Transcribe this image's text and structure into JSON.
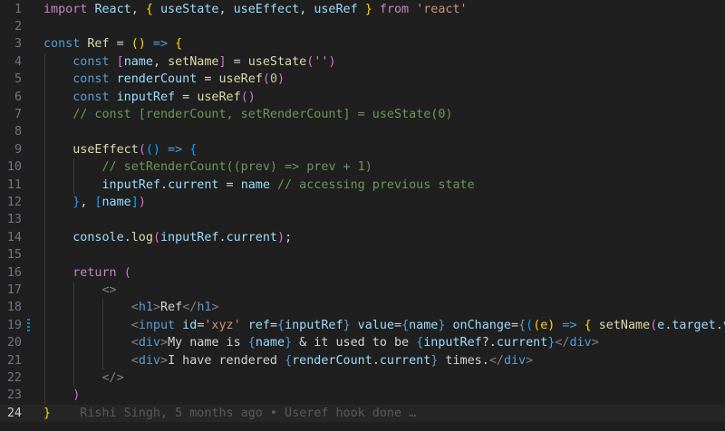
{
  "editor": {
    "current_line": 24,
    "modified_line": 19,
    "lines": [
      {
        "n": "1",
        "tokens": [
          [
            "import ",
            "kc"
          ],
          [
            "React",
            "v"
          ],
          [
            ", ",
            "plain"
          ],
          [
            "{ ",
            "b1"
          ],
          [
            "useState",
            "v"
          ],
          [
            ", ",
            "plain"
          ],
          [
            "useEffect",
            "v"
          ],
          [
            ", ",
            "plain"
          ],
          [
            "useRef",
            "v"
          ],
          [
            " }",
            "b1"
          ],
          [
            " from ",
            "kc"
          ],
          [
            "'react'",
            "s"
          ]
        ]
      },
      {
        "n": "2",
        "tokens": []
      },
      {
        "n": "3",
        "tokens": [
          [
            "const ",
            "k"
          ],
          [
            "Ref",
            "f"
          ],
          [
            " = ",
            "plain"
          ],
          [
            "()",
            "b1"
          ],
          [
            " => ",
            "k"
          ],
          [
            "{",
            "b1"
          ]
        ]
      },
      {
        "n": "4",
        "tokens": [
          [
            "    ",
            "plain"
          ],
          [
            "const ",
            "k"
          ],
          [
            "[",
            "b2"
          ],
          [
            "name",
            "v"
          ],
          [
            ", ",
            "plain"
          ],
          [
            "setName",
            "f"
          ],
          [
            "]",
            "b2"
          ],
          [
            " = ",
            "plain"
          ],
          [
            "useState",
            "f"
          ],
          [
            "(",
            "b2"
          ],
          [
            "''",
            "s"
          ],
          [
            ")",
            "b2"
          ]
        ]
      },
      {
        "n": "5",
        "tokens": [
          [
            "    ",
            "plain"
          ],
          [
            "const ",
            "k"
          ],
          [
            "renderCount",
            "v"
          ],
          [
            " = ",
            "plain"
          ],
          [
            "useRef",
            "f"
          ],
          [
            "(",
            "b2"
          ],
          [
            "0",
            "n"
          ],
          [
            ")",
            "b2"
          ]
        ]
      },
      {
        "n": "6",
        "tokens": [
          [
            "    ",
            "plain"
          ],
          [
            "const ",
            "k"
          ],
          [
            "inputRef",
            "v"
          ],
          [
            " = ",
            "plain"
          ],
          [
            "useRef",
            "f"
          ],
          [
            "()",
            "b2"
          ]
        ]
      },
      {
        "n": "7",
        "tokens": [
          [
            "    ",
            "plain"
          ],
          [
            "// const [renderCount, setRenderCount] = useState(0)",
            "c"
          ]
        ]
      },
      {
        "n": "8",
        "tokens": []
      },
      {
        "n": "9",
        "tokens": [
          [
            "    ",
            "plain"
          ],
          [
            "useEffect",
            "f"
          ],
          [
            "(",
            "b2"
          ],
          [
            "()",
            "b3"
          ],
          [
            " => ",
            "k"
          ],
          [
            "{",
            "b3"
          ]
        ]
      },
      {
        "n": "10",
        "tokens": [
          [
            "        ",
            "plain"
          ],
          [
            "// setRenderCount((prev) => prev + 1)",
            "c"
          ]
        ]
      },
      {
        "n": "11",
        "tokens": [
          [
            "        ",
            "plain"
          ],
          [
            "inputRef",
            "v"
          ],
          [
            ".",
            "plain"
          ],
          [
            "current",
            "v"
          ],
          [
            " = ",
            "plain"
          ],
          [
            "name",
            "v"
          ],
          [
            " // accessing previous state",
            "c"
          ]
        ]
      },
      {
        "n": "12",
        "tokens": [
          [
            "    ",
            "plain"
          ],
          [
            "}",
            "b3"
          ],
          [
            ", ",
            "plain"
          ],
          [
            "[",
            "b3"
          ],
          [
            "name",
            "v"
          ],
          [
            "]",
            "b3"
          ],
          [
            ")",
            "b2"
          ]
        ]
      },
      {
        "n": "13",
        "tokens": []
      },
      {
        "n": "14",
        "tokens": [
          [
            "    ",
            "plain"
          ],
          [
            "console",
            "v"
          ],
          [
            ".",
            "plain"
          ],
          [
            "log",
            "f"
          ],
          [
            "(",
            "b2"
          ],
          [
            "inputRef",
            "v"
          ],
          [
            ".",
            "plain"
          ],
          [
            "current",
            "v"
          ],
          [
            ")",
            "b2"
          ],
          [
            ";",
            "plain"
          ]
        ]
      },
      {
        "n": "15",
        "tokens": []
      },
      {
        "n": "16",
        "tokens": [
          [
            "    ",
            "plain"
          ],
          [
            "return ",
            "kc"
          ],
          [
            "(",
            "b2"
          ]
        ]
      },
      {
        "n": "17",
        "tokens": [
          [
            "        ",
            "plain"
          ],
          [
            "<>",
            "p"
          ]
        ]
      },
      {
        "n": "18",
        "tokens": [
          [
            "            ",
            "plain"
          ],
          [
            "<",
            "p"
          ],
          [
            "h1",
            "t"
          ],
          [
            ">",
            "p"
          ],
          [
            "Ref",
            "plain"
          ],
          [
            "</",
            "p"
          ],
          [
            "h1",
            "t"
          ],
          [
            ">",
            "p"
          ]
        ]
      },
      {
        "n": "19",
        "tokens": [
          [
            "            ",
            "plain"
          ],
          [
            "<",
            "p"
          ],
          [
            "input",
            "t"
          ],
          [
            " id",
            "a"
          ],
          [
            "=",
            "plain"
          ],
          [
            "'xyz'",
            "s"
          ],
          [
            " ref",
            "a"
          ],
          [
            "=",
            "plain"
          ],
          [
            "{",
            "k"
          ],
          [
            "inputRef",
            "v"
          ],
          [
            "}",
            "k"
          ],
          [
            " value",
            "a"
          ],
          [
            "=",
            "plain"
          ],
          [
            "{",
            "k"
          ],
          [
            "name",
            "v"
          ],
          [
            "}",
            "k"
          ],
          [
            " onChange",
            "a"
          ],
          [
            "=",
            "plain"
          ],
          [
            "{",
            "k"
          ],
          [
            "(",
            "b3"
          ],
          [
            "(e)",
            "b1"
          ],
          [
            " => ",
            "k"
          ],
          [
            "{ ",
            "b1"
          ],
          [
            "setName",
            "f"
          ],
          [
            "(",
            "b2"
          ],
          [
            "e",
            "v"
          ],
          [
            ".",
            "plain"
          ],
          [
            "target",
            "v"
          ],
          [
            ".",
            "plain"
          ],
          [
            "val",
            "v"
          ]
        ]
      },
      {
        "n": "20",
        "tokens": [
          [
            "            ",
            "plain"
          ],
          [
            "<",
            "p"
          ],
          [
            "div",
            "t"
          ],
          [
            ">",
            "p"
          ],
          [
            "My name is ",
            "plain"
          ],
          [
            "{",
            "k"
          ],
          [
            "name",
            "v"
          ],
          [
            "}",
            "k"
          ],
          [
            " & it used to be ",
            "plain"
          ],
          [
            "{",
            "k"
          ],
          [
            "inputRef",
            "v"
          ],
          [
            "?.",
            "plain"
          ],
          [
            "current",
            "v"
          ],
          [
            "}",
            "k"
          ],
          [
            "</",
            "p"
          ],
          [
            "div",
            "t"
          ],
          [
            ">",
            "p"
          ]
        ]
      },
      {
        "n": "21",
        "tokens": [
          [
            "            ",
            "plain"
          ],
          [
            "<",
            "p"
          ],
          [
            "div",
            "t"
          ],
          [
            ">",
            "p"
          ],
          [
            "I have rendered ",
            "plain"
          ],
          [
            "{",
            "k"
          ],
          [
            "renderCount",
            "v"
          ],
          [
            ".",
            "plain"
          ],
          [
            "current",
            "v"
          ],
          [
            "}",
            "k"
          ],
          [
            " times.",
            "plain"
          ],
          [
            "</",
            "p"
          ],
          [
            "div",
            "t"
          ],
          [
            ">",
            "p"
          ]
        ]
      },
      {
        "n": "22",
        "tokens": [
          [
            "        ",
            "plain"
          ],
          [
            "</>",
            "p"
          ]
        ]
      },
      {
        "n": "23",
        "tokens": [
          [
            "    ",
            "plain"
          ],
          [
            ")",
            "b2"
          ]
        ]
      },
      {
        "n": "24",
        "tokens": [
          [
            "}",
            "b1"
          ],
          [
            "    Rishi Singh, 5 months ago • Useref hook done …",
            "blame"
          ]
        ]
      }
    ]
  }
}
